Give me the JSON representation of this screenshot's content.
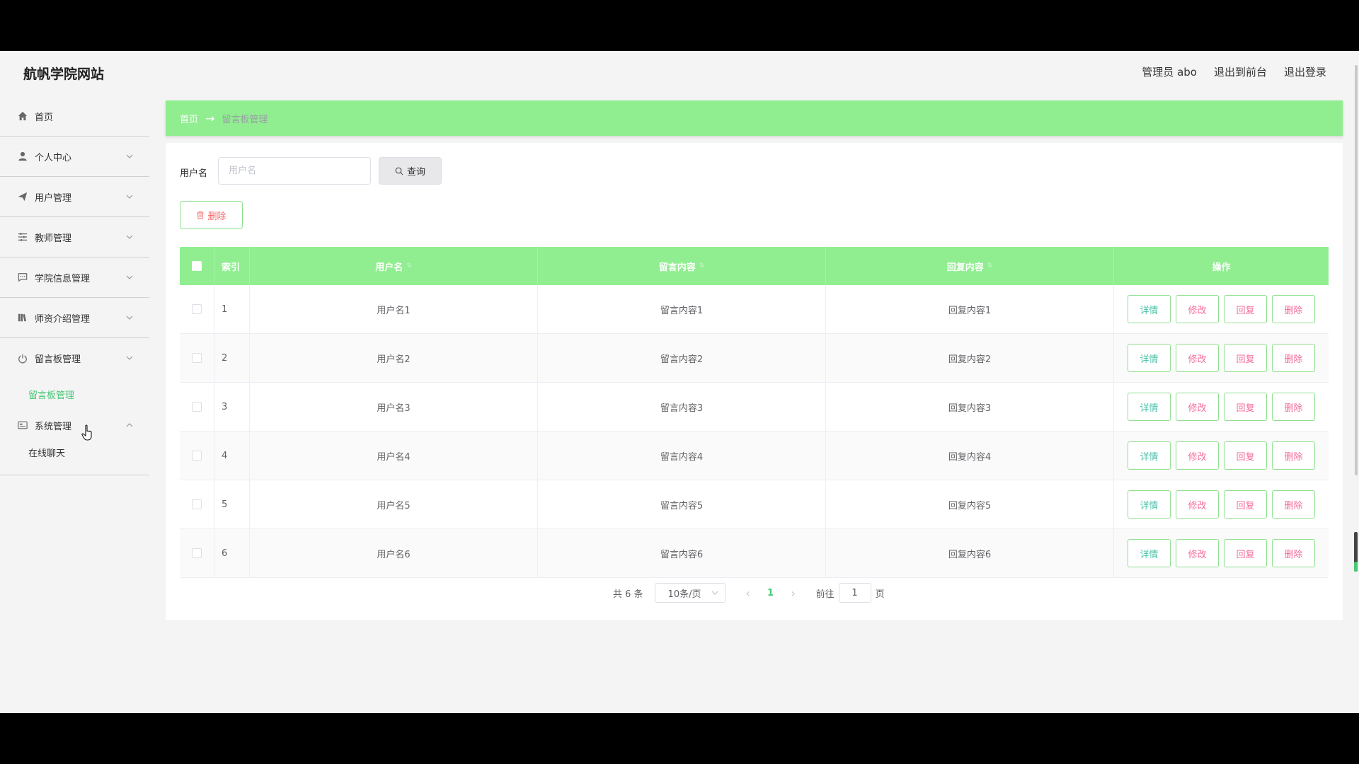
{
  "header": {
    "site_title": "航帆学院网站",
    "admin_label": "管理员 abo",
    "to_front_label": "退出到前台",
    "logout_label": "退出登录"
  },
  "sidebar": {
    "items": [
      {
        "label": "首页",
        "icon": "home-icon"
      },
      {
        "label": "个人中心",
        "icon": "user-icon"
      },
      {
        "label": "用户管理",
        "icon": "send-icon"
      },
      {
        "label": "教师管理",
        "icon": "sliders-icon"
      },
      {
        "label": "学院信息管理",
        "icon": "chat-icon"
      },
      {
        "label": "师资介绍管理",
        "icon": "library-icon"
      },
      {
        "label": "留言板管理",
        "icon": "power-icon"
      },
      {
        "label": "系统管理",
        "icon": "id-card-icon"
      }
    ],
    "message_sub": "留言板管理",
    "system_sub": "在线聊天"
  },
  "breadcrumb": {
    "home": "首页",
    "current": "留言板管理"
  },
  "search": {
    "label": "用户名",
    "placeholder": "用户名",
    "button": "查询"
  },
  "delete_button": "删除",
  "table": {
    "headers": {
      "index": "索引",
      "username": "用户名",
      "message": "留言内容",
      "reply": "回复内容",
      "ops": "操作"
    },
    "rows": [
      {
        "index": "1",
        "username": "用户名1",
        "message": "留言内容1",
        "reply": "回复内容1"
      },
      {
        "index": "2",
        "username": "用户名2",
        "message": "留言内容2",
        "reply": "回复内容2"
      },
      {
        "index": "3",
        "username": "用户名3",
        "message": "留言内容3",
        "reply": "回复内容3"
      },
      {
        "index": "4",
        "username": "用户名4",
        "message": "留言内容4",
        "reply": "回复内容4"
      },
      {
        "index": "5",
        "username": "用户名5",
        "message": "留言内容5",
        "reply": "回复内容5"
      },
      {
        "index": "6",
        "username": "用户名6",
        "message": "留言内容6",
        "reply": "回复内容6"
      }
    ],
    "op_labels": {
      "detail": "详情",
      "edit": "修改",
      "reply": "回复",
      "delete": "删除"
    }
  },
  "pagination": {
    "total": "共 6 条",
    "page_size": "10条/页",
    "current_page": "1",
    "goto_label": "前往",
    "goto_value": "1",
    "unit": "页"
  },
  "colors": {
    "accent_green": "#90ee90",
    "active_text": "#48c774",
    "danger": "#f56c6c"
  }
}
